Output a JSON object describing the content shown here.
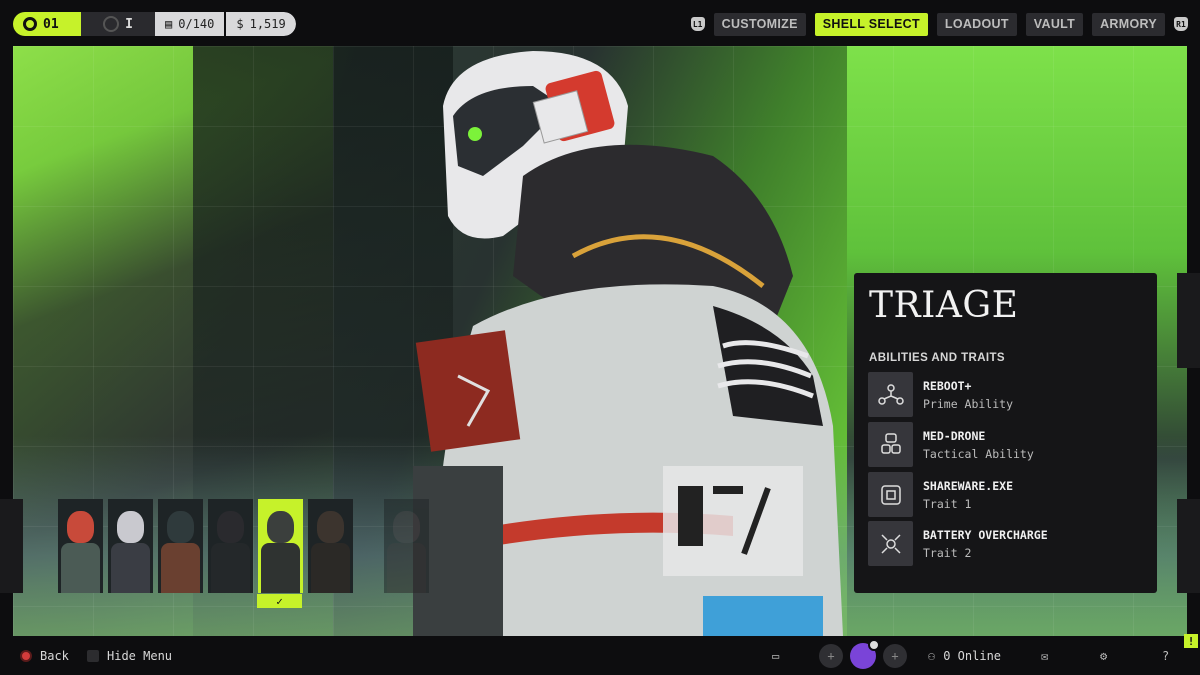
{
  "header": {
    "level": "01",
    "rank": "I",
    "stat1": "0/140",
    "stat2": "1,519",
    "left_bumper": "L1",
    "right_bumper": "R1",
    "nav": [
      "CUSTOMIZE",
      "SHELL SELECT",
      "LOADOUT",
      "VAULT",
      "ARMORY"
    ],
    "active_nav": "SHELL SELECT"
  },
  "roster": {
    "portraits": [
      {
        "head": "#c84a3a",
        "body": "#4b5b55"
      },
      {
        "head": "#c9c9cf",
        "body": "#3a3d44"
      },
      {
        "head": "#2f3a3c",
        "body": "#6a4030"
      },
      {
        "head": "#2a2a2e",
        "body": "#24282a"
      },
      {
        "head": "#3b3f3d",
        "body": "#2f3331"
      },
      {
        "head": "#3c342e",
        "body": "#2b2926"
      },
      {
        "head": "#3a3438",
        "body": "#2a2628"
      }
    ],
    "selected_index": 4,
    "selected_mark": "✓"
  },
  "shell": {
    "name": "TRIAGE",
    "section_label": "ABILITIES AND TRAITS",
    "abilities": [
      {
        "name": "REBOOT+",
        "type": "Prime Ability",
        "icon": "network-icon"
      },
      {
        "name": "MED-DRONE",
        "type": "Tactical Ability",
        "icon": "drone-icon"
      },
      {
        "name": "SHAREWARE.EXE",
        "type": "Trait 1",
        "icon": "share-icon"
      },
      {
        "name": "BATTERY OVERCHARGE",
        "type": "Trait 2",
        "icon": "battery-burst-icon"
      }
    ]
  },
  "footer": {
    "back": "Back",
    "hide_menu": "Hide Menu",
    "online": "0 Online",
    "help": "?"
  },
  "colors": {
    "accent": "#c6f22a",
    "panel": "#151517"
  }
}
